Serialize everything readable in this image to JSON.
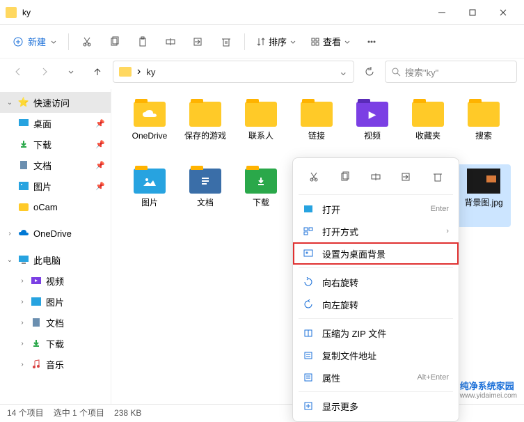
{
  "window": {
    "title": "ky"
  },
  "toolbar": {
    "new_label": "新建",
    "sort_label": "排序",
    "view_label": "查看"
  },
  "address": {
    "crumb": "ky",
    "arrow": "›"
  },
  "search": {
    "placeholder": "搜索\"ky\""
  },
  "sidebar": {
    "quick": "快速访问",
    "desktop": "桌面",
    "downloads": "下载",
    "documents": "文档",
    "pictures": "图片",
    "ocam": "oCam",
    "onedrive": "OneDrive",
    "this_pc": "此电脑",
    "video": "视频",
    "pictures2": "图片",
    "documents2": "文档",
    "downloads2": "下载",
    "music": "音乐"
  },
  "items": [
    {
      "label": "OneDrive",
      "glyph_svg": "cloud"
    },
    {
      "label": "保存的游戏"
    },
    {
      "label": "联系人"
    },
    {
      "label": "链接"
    },
    {
      "label": "视频",
      "variant": "video",
      "glyph": "▶"
    },
    {
      "label": "收藏夹"
    },
    {
      "label": "搜索"
    },
    {
      "label": "图片",
      "variant": "pic"
    },
    {
      "label": "文档",
      "variant": "doc"
    },
    {
      "label": "下载",
      "variant": "dl"
    },
    {
      "label": "背景图.jpg",
      "kind": "jpg",
      "selected": true
    }
  ],
  "context_menu": {
    "open": "打开",
    "open_accel": "Enter",
    "open_with": "打开方式",
    "set_desktop": "设置为桌面背景",
    "rotate_right": "向右旋转",
    "rotate_left": "向左旋转",
    "compress_zip": "压缩为 ZIP 文件",
    "copy_path": "复制文件地址",
    "properties": "属性",
    "properties_accel": "Alt+Enter",
    "show_more": "显示更多"
  },
  "statusbar": {
    "count": "14 个项目",
    "selected": "选中 1 个项目",
    "size": "238 KB"
  },
  "watermark": {
    "line1": "纯净系统家园",
    "line2": "www.yidaimei.com"
  }
}
